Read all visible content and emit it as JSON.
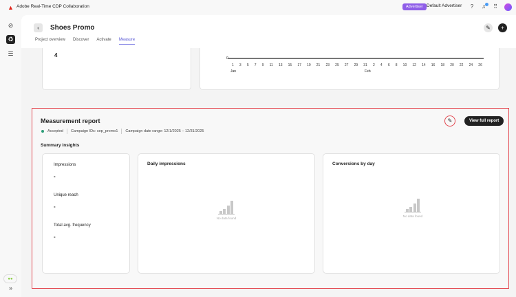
{
  "app": {
    "title": "Adobe Real-Time CDP Collaboration",
    "badge": "Advertiser",
    "account": "Default Advertiser"
  },
  "page": {
    "title": "Shoes Promo",
    "tabs": [
      "Project overview",
      "Discover",
      "Activate",
      "Measure"
    ],
    "active_tab": "Measure"
  },
  "top_cards": {
    "left_value": "4",
    "chart": {
      "y_zero": "0",
      "ticks": [
        "1",
        "3",
        "5",
        "7",
        "9",
        "11",
        "13",
        "15",
        "17",
        "19",
        "21",
        "23",
        "25",
        "27",
        "29",
        "31",
        "2",
        "4",
        "6",
        "8",
        "10",
        "12",
        "14",
        "16",
        "18",
        "20",
        "22",
        "24",
        "26"
      ],
      "months": [
        "Jan",
        "Feb"
      ]
    }
  },
  "report": {
    "title": "Measurement report",
    "status": "Accepted",
    "campaign_ids": "Campaign IDs: sep_promo1",
    "date_range": "Campaign date range: 12/1/2025 – 12/31/2025",
    "view_button": "View full report",
    "summary_title": "Summary insights",
    "metrics": [
      {
        "label": "Impressions",
        "value": "-"
      },
      {
        "label": "Unique reach",
        "value": "-"
      },
      {
        "label": "Total avg. frequency",
        "value": "-"
      }
    ],
    "charts": [
      {
        "title": "Daily impressions",
        "empty": "No data found"
      },
      {
        "title": "Conversions by day",
        "empty": "No data found"
      }
    ]
  },
  "colors": {
    "accent": "#8f5ee8",
    "highlight": "#e34850",
    "status": "#2d9d78"
  }
}
